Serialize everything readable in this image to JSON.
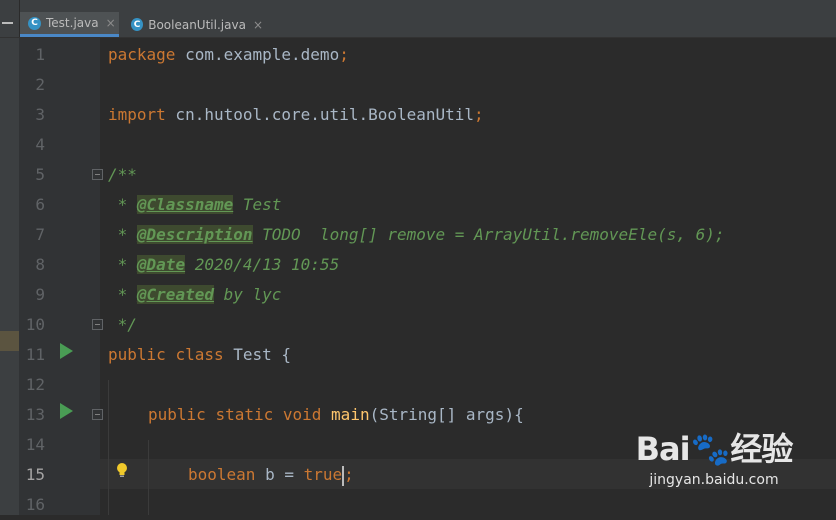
{
  "tabs": [
    {
      "label": "Test.java",
      "icon": "java-class-icon",
      "icon_glyph": "C",
      "active": true
    },
    {
      "label": "BooleanUtil.java",
      "icon": "java-class-icon",
      "icon_glyph": "C",
      "active": false
    }
  ],
  "close_glyph": "×",
  "line_numbers": [
    "1",
    "2",
    "3",
    "4",
    "5",
    "6",
    "7",
    "8",
    "9",
    "10",
    "11",
    "12",
    "13",
    "14",
    "15",
    "16"
  ],
  "code": {
    "l1": {
      "kw": "package",
      "rest": " com.example.demo",
      "semi": ";"
    },
    "l3": {
      "kw": "import",
      "rest": " cn.hutool.core.util.BooleanUtil",
      "semi": ";"
    },
    "l5": "/**",
    "l6": {
      "star": " * ",
      "tag": "@Classname",
      "text": " Test"
    },
    "l7": {
      "star": " * ",
      "tag": "@Description",
      "text": " TODO  long[] remove = ArrayUtil.removeEle(s, 6);"
    },
    "l8": {
      "star": " * ",
      "tag": "@Date",
      "text": " 2020/4/13 10:55"
    },
    "l9": {
      "star": " * ",
      "tag": "@Created",
      "text": " by lyc"
    },
    "l10": " */",
    "l11": {
      "kw1": "public",
      "kw2": "class",
      "rest": " Test {"
    },
    "l13": {
      "kw1": "public",
      "kw2": "static",
      "kw3": "void",
      "fn": "main",
      "rest": "(String[] args){"
    },
    "l15": {
      "kw": "boolean",
      "mid": " b = ",
      "val": "true",
      "semi": ";"
    }
  },
  "watermark": {
    "logo_left": "Bai",
    "logo_right": "经验",
    "url": "jingyan.baidu.com"
  },
  "colors": {
    "keyword": "#cc7832",
    "doc": "#629755",
    "text": "#a9b7c6",
    "method": "#ffc66d"
  }
}
